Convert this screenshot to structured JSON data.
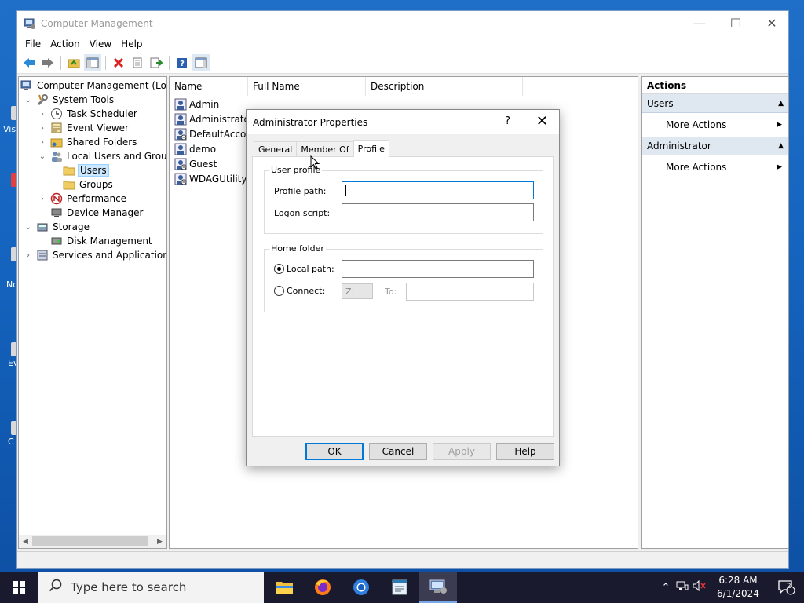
{
  "desktop": {
    "icon_labels": [
      "Vis",
      "No",
      "Ev",
      "C"
    ]
  },
  "window": {
    "title": "Computer Management",
    "controls": {
      "minimize": "—",
      "maximize": "☐",
      "close": "✕"
    }
  },
  "menu": {
    "file": "File",
    "action": "Action",
    "view": "View",
    "help": "Help"
  },
  "tree": {
    "root": "Computer Management (Local",
    "system_tools": "System Tools",
    "task_scheduler": "Task Scheduler",
    "event_viewer": "Event Viewer",
    "shared_folders": "Shared Folders",
    "local_users_groups": "Local Users and Groups",
    "users": "Users",
    "groups": "Groups",
    "performance": "Performance",
    "device_manager": "Device Manager",
    "storage": "Storage",
    "disk_management": "Disk Management",
    "services_apps": "Services and Applications"
  },
  "list": {
    "columns": {
      "name": "Name",
      "full_name": "Full Name",
      "description": "Description"
    },
    "rows": [
      "Admin",
      "Administrator",
      "DefaultAcco...",
      "demo",
      "Guest",
      "WDAGUtility..."
    ]
  },
  "actions": {
    "title": "Actions",
    "section1": "Users",
    "section1_item": "More Actions",
    "section2": "Administrator",
    "section2_item": "More Actions"
  },
  "dialog": {
    "title": "Administrator Properties",
    "help": "?",
    "close": "✕",
    "tabs": {
      "general": "General",
      "member_of": "Member Of",
      "profile": "Profile"
    },
    "user_profile": {
      "group_label": "User profile",
      "profile_path_label": "Profile path:",
      "profile_path_value": "",
      "logon_script_label": "Logon script:",
      "logon_script_value": ""
    },
    "home_folder": {
      "group_label": "Home folder",
      "local_path_label": "Local path:",
      "local_path_value": "",
      "connect_label": "Connect:",
      "drive_value": "Z:",
      "to_label": "To:",
      "to_value": "",
      "selected_option": "Local path"
    },
    "buttons": {
      "ok": "OK",
      "cancel": "Cancel",
      "apply": "Apply",
      "help": "Help"
    }
  },
  "taskbar": {
    "search_placeholder": "Type here to search",
    "time": "6:28 AM",
    "date": "6/1/2024",
    "notification_count": "2"
  },
  "colors": {
    "accent": "#0078d7",
    "selection": "#cce8ff",
    "actions_section_bg": "#dfe7f1",
    "taskbar_bg": "#1a1a2e",
    "desktop_bg": "#1565c0"
  }
}
